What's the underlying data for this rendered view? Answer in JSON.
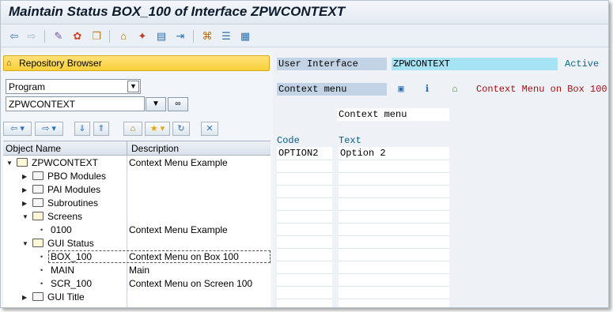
{
  "window": {
    "title": "Maintain Status BOX_100 of Interface ZPWCONTEXT"
  },
  "toolbar": {
    "icons": [
      "back-arrow-icon",
      "forward-arrow-icon",
      "glasses-pencil-icon",
      "activate-icon",
      "copy-object-icon",
      "hierarchy-icon",
      "magic-wand-icon",
      "display-object-list-icon",
      "navigate-icon",
      "where-used-icon",
      "stack-icon",
      "list-icon"
    ]
  },
  "repository": {
    "header": "Repository Browser",
    "object_type": "Program",
    "object_name": "ZPWCONTEXT",
    "columns": {
      "name": "Object Name",
      "description": "Description"
    },
    "tree": [
      {
        "level": 0,
        "expanded": true,
        "type": "folder",
        "name": "ZPWCONTEXT",
        "description": "Context Menu Example"
      },
      {
        "level": 1,
        "expanded": false,
        "type": "folder",
        "name": "PBO Modules",
        "description": ""
      },
      {
        "level": 1,
        "expanded": false,
        "type": "folder",
        "name": "PAI Modules",
        "description": ""
      },
      {
        "level": 1,
        "expanded": false,
        "type": "folder",
        "name": "Subroutines",
        "description": ""
      },
      {
        "level": 1,
        "expanded": true,
        "type": "folder",
        "name": "Screens",
        "description": ""
      },
      {
        "level": 2,
        "expanded": false,
        "type": "leaf",
        "name": "0100",
        "description": "Context Menu Example"
      },
      {
        "level": 1,
        "expanded": true,
        "type": "folder",
        "name": "GUI Status",
        "description": ""
      },
      {
        "level": 2,
        "expanded": false,
        "type": "leaf",
        "name": "BOX_100",
        "description": "Context Menu on Box 100",
        "selected": true
      },
      {
        "level": 2,
        "expanded": false,
        "type": "leaf",
        "name": "MAIN",
        "description": "Main"
      },
      {
        "level": 2,
        "expanded": false,
        "type": "leaf",
        "name": "SCR_100",
        "description": "Context Menu on Screen 100"
      },
      {
        "level": 1,
        "expanded": false,
        "type": "folder",
        "name": "GUI Title",
        "description": ""
      }
    ]
  },
  "editor": {
    "ui_label": "User Interface",
    "ui_value": "ZPWCONTEXT",
    "ui_status": "Active",
    "status_type_label": "Context menu",
    "status_description": "Context Menu on Box 100",
    "menu_title": "Context menu",
    "code_header": "Code",
    "text_header": "Text",
    "entries": [
      {
        "code": "OPTION2",
        "text": "Option 2"
      }
    ]
  },
  "colors": {
    "accent_yellow": "#f9cf3a",
    "label_blue": "#c3d3e6",
    "value_cyan": "#a6e3f5",
    "status_teal": "#0a6a8a",
    "description_red": "#a01010"
  }
}
